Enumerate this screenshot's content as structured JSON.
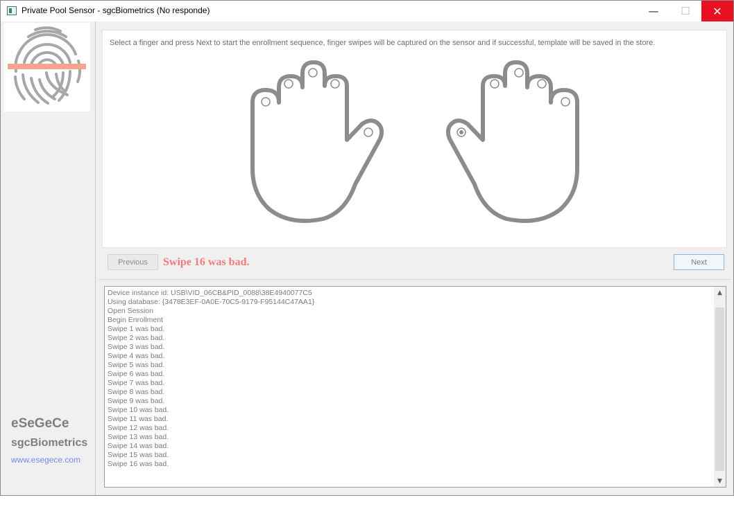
{
  "window": {
    "title": "Private Pool Sensor - sgcBiometrics (No responde)",
    "min_glyph": "—",
    "max_glyph": "☐",
    "close_glyph": "✕"
  },
  "sidebar": {
    "brand_name": "eSeGeCe",
    "product_name": "sgcBiometrics",
    "website": "www.esegece.com",
    "logo_icon": "fingerprint-icon"
  },
  "enrollment": {
    "instruction": "Select a finger and press Next to start the enrollment sequence, finger swipes will be captured on the sensor and if successful, template will be saved in the store.",
    "selected_finger": "right-thumb",
    "previous_label": "Previous",
    "next_label": "Next",
    "status": "Swipe 16 was bad."
  },
  "log": {
    "lines": [
      "Device instance id: USB\\VID_06CB&PID_0088\\38E4940077C5",
      "Using database: {3478E3EF-0A0E-70C5-9179-F95144C47AA1}",
      "Open Session",
      "Begin Enrollment",
      "Swipe 1 was bad.",
      "Swipe 2 was bad.",
      "Swipe 3 was bad.",
      "Swipe 4 was bad.",
      "Swipe 5 was bad.",
      "Swipe 6 was bad.",
      "Swipe 7 was bad.",
      "Swipe 8 was bad.",
      "Swipe 9 was bad.",
      "Swipe 10 was bad.",
      "Swipe 11 was bad.",
      "Swipe 12 was bad.",
      "Swipe 13 was bad.",
      "Swipe 14 was bad.",
      "Swipe 15 was bad.",
      "Swipe 16 was bad."
    ]
  },
  "colors": {
    "status": "#f07b7b",
    "link": "#7b85ef",
    "hand_outline": "#8c8c8c",
    "fingerprint_bar": "#f4a58e",
    "close_button": "#e81123"
  }
}
